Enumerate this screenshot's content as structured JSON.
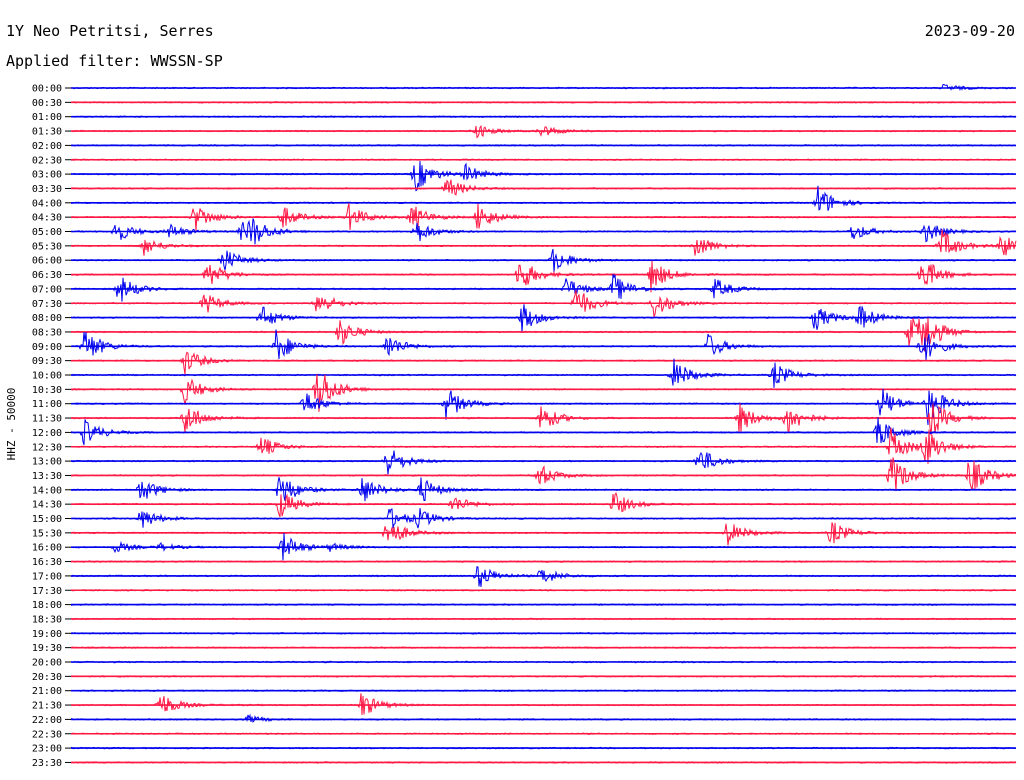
{
  "header": {
    "station": "1Y Neo Petritsi, Serres",
    "date": "2023-09-20",
    "filter": "Applied filter: WWSSN-SP"
  },
  "chart_data": {
    "type": "line",
    "title": "1Y Neo Petritsi, Serres",
    "subtitle": "Applied filter: WWSSN-SP",
    "ylabel": "HHZ - 50000",
    "row_labels": [
      "00:00",
      "00:30",
      "01:00",
      "01:30",
      "02:00",
      "02:30",
      "03:00",
      "03:30",
      "04:00",
      "04:30",
      "05:00",
      "05:30",
      "06:00",
      "06:30",
      "07:00",
      "07:30",
      "08:00",
      "08:30",
      "09:00",
      "09:30",
      "10:00",
      "10:30",
      "11:00",
      "11:30",
      "12:00",
      "12:30",
      "13:00",
      "13:30",
      "14:00",
      "14:30",
      "15:00",
      "15:30",
      "16:00",
      "16:30",
      "17:00",
      "17:30",
      "18:00",
      "18:30",
      "19:00",
      "19:30",
      "20:00",
      "20:30",
      "21:00",
      "21:30",
      "22:00",
      "22:30",
      "23:00",
      "23:30"
    ],
    "colors": {
      "even_rows": "#0000ee",
      "odd_rows": "#ff1744",
      "axis": "#000000"
    },
    "minutes_per_row": 30,
    "events": [
      {
        "row": 0,
        "minute": 27.7,
        "amp": 4
      },
      {
        "row": 3,
        "minute": 12.8,
        "amp": 8
      },
      {
        "row": 3,
        "minute": 14.9,
        "amp": 7
      },
      {
        "row": 6,
        "minute": 10.9,
        "amp": 20
      },
      {
        "row": 6,
        "minute": 12.5,
        "amp": 10
      },
      {
        "row": 7,
        "minute": 11.9,
        "amp": 12
      },
      {
        "row": 8,
        "minute": 23.7,
        "amp": 18
      },
      {
        "row": 9,
        "minute": 3.9,
        "amp": 16
      },
      {
        "row": 9,
        "minute": 6.7,
        "amp": 12
      },
      {
        "row": 9,
        "minute": 8.8,
        "amp": 14
      },
      {
        "row": 9,
        "minute": 10.8,
        "amp": 14
      },
      {
        "row": 9,
        "minute": 12.9,
        "amp": 16
      },
      {
        "row": 10,
        "minute": 1.4,
        "amp": 12
      },
      {
        "row": 10,
        "minute": 3.1,
        "amp": 8
      },
      {
        "row": 10,
        "minute": 5.4,
        "amp": 10
      },
      {
        "row": 10,
        "minute": 5.7,
        "amp": 14
      },
      {
        "row": 10,
        "minute": 10.9,
        "amp": 14
      },
      {
        "row": 10,
        "minute": 24.8,
        "amp": 10
      },
      {
        "row": 10,
        "minute": 27.1,
        "amp": 12
      },
      {
        "row": 11,
        "minute": 2.3,
        "amp": 10
      },
      {
        "row": 11,
        "minute": 19.8,
        "amp": 14
      },
      {
        "row": 11,
        "minute": 27.6,
        "amp": 18
      },
      {
        "row": 11,
        "minute": 29.5,
        "amp": 14
      },
      {
        "row": 12,
        "minute": 4.8,
        "amp": 14
      },
      {
        "row": 12,
        "minute": 15.3,
        "amp": 14
      },
      {
        "row": 13,
        "minute": 4.3,
        "amp": 16
      },
      {
        "row": 13,
        "minute": 14.2,
        "amp": 20
      },
      {
        "row": 13,
        "minute": 18.4,
        "amp": 18
      },
      {
        "row": 13,
        "minute": 27.0,
        "amp": 20
      },
      {
        "row": 14,
        "minute": 1.5,
        "amp": 16
      },
      {
        "row": 14,
        "minute": 15.7,
        "amp": 12
      },
      {
        "row": 14,
        "minute": 17.2,
        "amp": 16
      },
      {
        "row": 14,
        "minute": 20.4,
        "amp": 12
      },
      {
        "row": 15,
        "minute": 4.2,
        "amp": 12
      },
      {
        "row": 15,
        "minute": 7.8,
        "amp": 14
      },
      {
        "row": 15,
        "minute": 16.0,
        "amp": 18
      },
      {
        "row": 15,
        "minute": 18.5,
        "amp": 16
      },
      {
        "row": 16,
        "minute": 6.0,
        "amp": 14
      },
      {
        "row": 16,
        "minute": 14.3,
        "amp": 16
      },
      {
        "row": 16,
        "minute": 23.6,
        "amp": 14
      },
      {
        "row": 16,
        "minute": 25.0,
        "amp": 14
      },
      {
        "row": 17,
        "minute": 8.5,
        "amp": 16
      },
      {
        "row": 17,
        "minute": 26.6,
        "amp": 18
      },
      {
        "row": 17,
        "minute": 27.0,
        "amp": 22
      },
      {
        "row": 18,
        "minute": 0.4,
        "amp": 20
      },
      {
        "row": 18,
        "minute": 6.5,
        "amp": 18
      },
      {
        "row": 18,
        "minute": 10.0,
        "amp": 14
      },
      {
        "row": 18,
        "minute": 20.2,
        "amp": 14
      },
      {
        "row": 18,
        "minute": 27.0,
        "amp": 20
      },
      {
        "row": 19,
        "minute": 3.6,
        "amp": 14
      },
      {
        "row": 20,
        "minute": 19.1,
        "amp": 18
      },
      {
        "row": 20,
        "minute": 22.3,
        "amp": 14
      },
      {
        "row": 21,
        "minute": 3.6,
        "amp": 16
      },
      {
        "row": 21,
        "minute": 7.8,
        "amp": 30
      },
      {
        "row": 22,
        "minute": 7.4,
        "amp": 14
      },
      {
        "row": 22,
        "minute": 11.9,
        "amp": 18
      },
      {
        "row": 22,
        "minute": 25.7,
        "amp": 18
      },
      {
        "row": 22,
        "minute": 27.2,
        "amp": 22
      },
      {
        "row": 23,
        "minute": 3.6,
        "amp": 18
      },
      {
        "row": 23,
        "minute": 14.9,
        "amp": 16
      },
      {
        "row": 23,
        "minute": 21.2,
        "amp": 16
      },
      {
        "row": 23,
        "minute": 22.7,
        "amp": 18
      },
      {
        "row": 23,
        "minute": 27.3,
        "amp": 20
      },
      {
        "row": 24,
        "minute": 0.4,
        "amp": 14
      },
      {
        "row": 24,
        "minute": 25.6,
        "amp": 16
      },
      {
        "row": 25,
        "minute": 6.0,
        "amp": 12
      },
      {
        "row": 25,
        "minute": 26.0,
        "amp": 20
      },
      {
        "row": 25,
        "minute": 27.1,
        "amp": 22
      },
      {
        "row": 26,
        "minute": 10.0,
        "amp": 18
      },
      {
        "row": 26,
        "minute": 19.9,
        "amp": 16
      },
      {
        "row": 27,
        "minute": 14.8,
        "amp": 14
      },
      {
        "row": 27,
        "minute": 26.0,
        "amp": 24
      },
      {
        "row": 27,
        "minute": 28.5,
        "amp": 22
      },
      {
        "row": 28,
        "minute": 2.2,
        "amp": 14
      },
      {
        "row": 28,
        "minute": 6.6,
        "amp": 20
      },
      {
        "row": 28,
        "minute": 9.2,
        "amp": 16
      },
      {
        "row": 28,
        "minute": 11.1,
        "amp": 14
      },
      {
        "row": 29,
        "minute": 6.6,
        "amp": 16
      },
      {
        "row": 29,
        "minute": 12.1,
        "amp": 10
      },
      {
        "row": 29,
        "minute": 17.2,
        "amp": 14
      },
      {
        "row": 30,
        "minute": 2.2,
        "amp": 12
      },
      {
        "row": 30,
        "minute": 10.1,
        "amp": 12
      },
      {
        "row": 30,
        "minute": 11.0,
        "amp": 10
      },
      {
        "row": 31,
        "minute": 10.0,
        "amp": 18
      },
      {
        "row": 31,
        "minute": 20.8,
        "amp": 14
      },
      {
        "row": 31,
        "minute": 24.1,
        "amp": 14
      },
      {
        "row": 32,
        "minute": 1.4,
        "amp": 6
      },
      {
        "row": 32,
        "minute": 2.8,
        "amp": 4
      },
      {
        "row": 32,
        "minute": 6.7,
        "amp": 16
      },
      {
        "row": 32,
        "minute": 8.2,
        "amp": 4
      },
      {
        "row": 34,
        "minute": 12.9,
        "amp": 14
      },
      {
        "row": 34,
        "minute": 14.9,
        "amp": 10
      },
      {
        "row": 43,
        "minute": 2.8,
        "amp": 14
      },
      {
        "row": 43,
        "minute": 9.2,
        "amp": 14
      },
      {
        "row": 44,
        "minute": 5.6,
        "amp": 4
      }
    ]
  }
}
